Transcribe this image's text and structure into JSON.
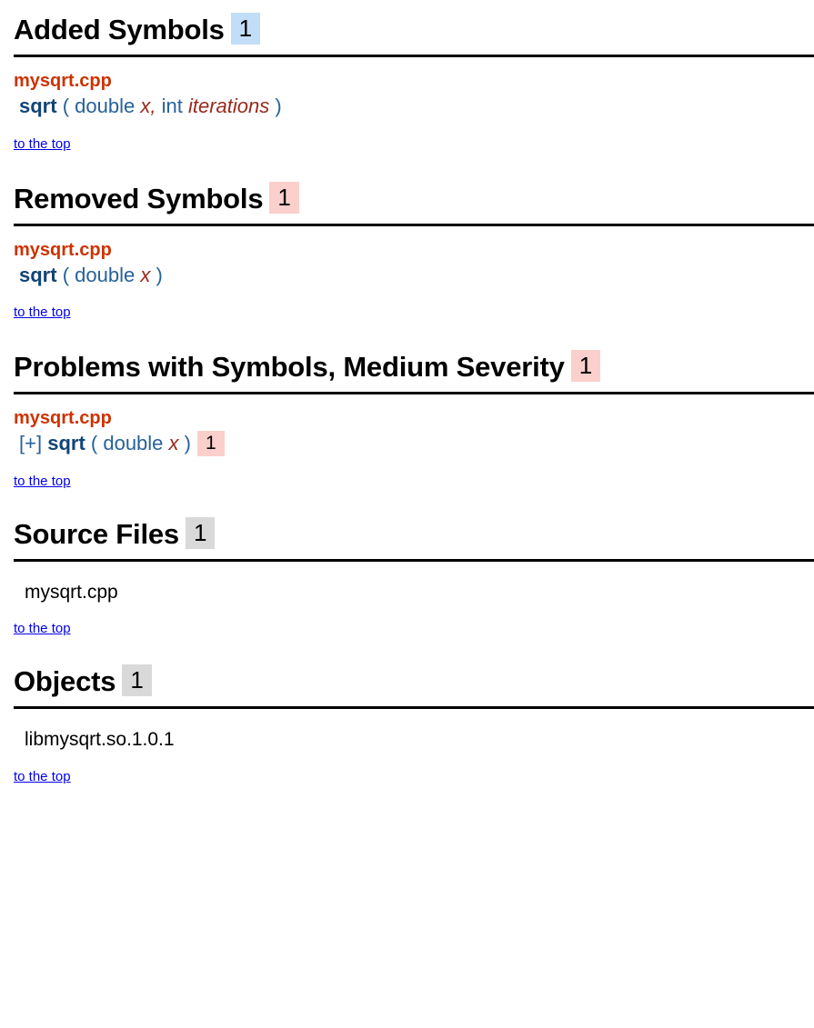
{
  "report": {
    "to_top_label": "to the top",
    "colors": {
      "badge_added": "#c2ddf7",
      "badge_removed": "#fbcfcb",
      "badge_problem": "#fbcfcb",
      "badge_neutral": "#d9d9d9",
      "file_name": "#cc3300",
      "symbol_name": "#114477",
      "type_name": "#26629b",
      "param_name": "#99291b",
      "link": "#0000ee",
      "rule": "#000000"
    },
    "sections": {
      "added": {
        "title": "Added Symbols",
        "count": "1",
        "file": "mysqrt.cpp",
        "symbol": {
          "name": "sqrt",
          "open_paren": "(",
          "type1": "double",
          "param1": "x",
          "comma": ",",
          "type2": "int",
          "param2": "iterations",
          "close_paren": ")"
        },
        "to_top": "to the top"
      },
      "removed": {
        "title": "Removed Symbols",
        "count": "1",
        "file": "mysqrt.cpp",
        "symbol": {
          "name": "sqrt",
          "open_paren": "(",
          "type1": "double",
          "param1": "x",
          "close_paren": ")"
        },
        "to_top": "to the top"
      },
      "problems": {
        "title": "Problems with Symbols, Medium Severity",
        "count": "1",
        "file": "mysqrt.cpp",
        "symbol": {
          "expander": "[+]",
          "name": "sqrt",
          "open_paren": "(",
          "type1": "double",
          "param1": "x",
          "close_paren": ")",
          "problem_count": "1"
        },
        "to_top": "to the top"
      },
      "source_files": {
        "title": "Source Files",
        "count": "1",
        "items": [
          "mysqrt.cpp"
        ],
        "to_top": "to the top"
      },
      "objects": {
        "title": "Objects",
        "count": "1",
        "items": [
          "libmysqrt.so.1.0.1"
        ],
        "to_top": "to the top"
      }
    }
  }
}
